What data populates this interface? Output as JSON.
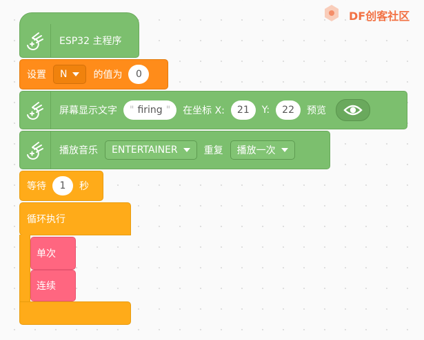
{
  "watermark": {
    "text": "DF创客社区"
  },
  "blocks": {
    "main": {
      "label": "ESP32 主程序"
    },
    "set_var": {
      "prefix": "设置",
      "var": "N",
      "mid": "的值为",
      "value": "0"
    },
    "screen_text": {
      "label": "屏幕显示文字",
      "quote_open": "\"",
      "text": "firing",
      "quote_close": "\"",
      "x_label": "在坐标 X:",
      "x": "21",
      "y_label": "Y:",
      "y": "22",
      "preview": "预览"
    },
    "music": {
      "label": "播放音乐",
      "melody": "ENTERTAINER",
      "repeat_label": "重复",
      "repeat": "播放一次"
    },
    "wait": {
      "prefix": "等待",
      "value": "1",
      "unit": "秒"
    },
    "loop": {
      "label": "循环执行"
    },
    "once": {
      "label": "单次"
    },
    "continuous": {
      "label": "连续"
    }
  },
  "colors": {
    "green": "#7cbf6e",
    "orange": "#ff8c1a",
    "yellow": "#ffab19",
    "pink": "#ff6680"
  },
  "icons": [
    "board-icon",
    "eye-icon",
    "caret-down-icon",
    "logo-icon"
  ]
}
